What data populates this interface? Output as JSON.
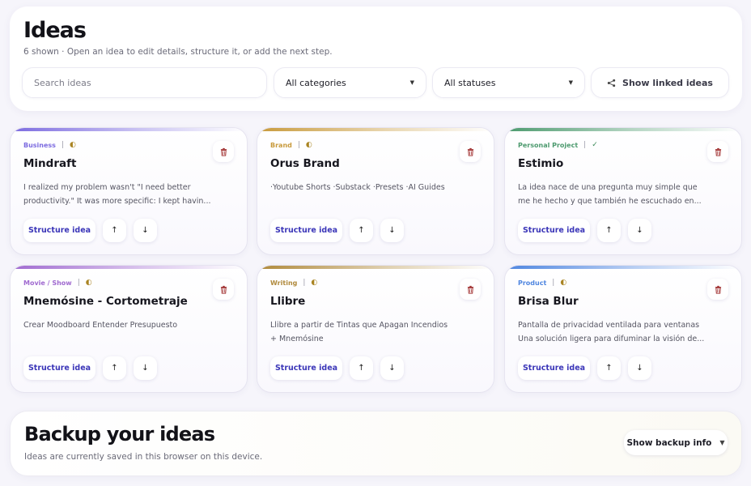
{
  "header": {
    "title": "Ideas",
    "subtitle": "6 shown · Open an idea to edit details, structure it, or add the next step.",
    "search_placeholder": "Search ideas",
    "category_select": "All categories",
    "status_select": "All statuses",
    "linked_button": "Show linked ideas"
  },
  "card_actions": {
    "structure": "Structure idea",
    "up": "↑",
    "down": "↓"
  },
  "ideas": [
    {
      "category": "Business",
      "category_color": "#7c6be0",
      "status_icon": "◐",
      "title": "Mindraft",
      "desc_line1": "I realized my problem wasn't \"I need better",
      "desc_line2": "productivity.\" It was more specific: I kept havin..."
    },
    {
      "category": "Brand",
      "category_color": "#c89a3c",
      "status_icon": "◐",
      "title": "Orus Brand",
      "desc_line1": "·Youtube Shorts ·Substack ·Presets ·AI Guides",
      "desc_line2": ""
    },
    {
      "category": "Personal Project",
      "category_color": "#4c9a6e",
      "status_icon": "✓",
      "title": "Estimio",
      "desc_line1": "La idea nace de una pregunta muy simple que",
      "desc_line2": "me he hecho y que también he escuchado en..."
    },
    {
      "category": "Movie / Show",
      "category_color": "#a06ad0",
      "status_icon": "◐",
      "title": "Mnemósine - Cortometraje",
      "desc_line1": "Crear Moodboard Entender Presupuesto",
      "desc_line2": ""
    },
    {
      "category": "Writing",
      "category_color": "#b08a3c",
      "status_icon": "◐",
      "title": "Llibre",
      "desc_line1": "Llibre a partir de Tintas que Apagan Incendios",
      "desc_line2": "+ Mnemósine"
    },
    {
      "category": "Product",
      "category_color": "#4f86e0",
      "status_icon": "◐",
      "title": "Brisa Blur",
      "desc_line1": "Pantalla de privacidad ventilada para ventanas",
      "desc_line2": "Una solución ligera para difuminar la visión de..."
    }
  ],
  "backup": {
    "title": "Backup your ideas",
    "subtitle": "Ideas are currently saved in this browser on this device.",
    "button": "Show backup info"
  }
}
